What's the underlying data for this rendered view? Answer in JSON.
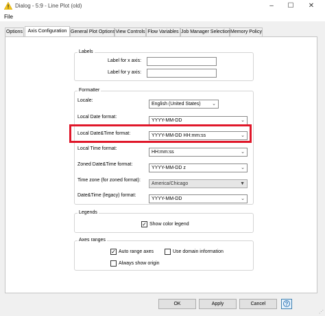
{
  "window": {
    "title": "Dialog - 5:9 - Line Plot (old)",
    "minimize": "–",
    "maximize": "☐",
    "close": "✕"
  },
  "menu": {
    "file": "File"
  },
  "tabs": [
    {
      "label": "Options",
      "active": false
    },
    {
      "label": "Axis Configuration",
      "active": true
    },
    {
      "label": "General Plot Options",
      "active": false
    },
    {
      "label": "View Controls",
      "active": false
    },
    {
      "label": "Flow Variables",
      "active": false
    },
    {
      "label": "Job Manager Selection",
      "active": false
    },
    {
      "label": "Memory Policy",
      "active": false
    }
  ],
  "labels_group": {
    "title": "Labels",
    "x_axis_label": "Label for x axis:",
    "x_axis_value": "",
    "y_axis_label": "Label for y axis:",
    "y_axis_value": ""
  },
  "formatter_group": {
    "title": "Formatter",
    "locale_label": "Locale:",
    "locale_value": "English (United States)",
    "local_date_label": "Local Date format:",
    "local_date_value": "YYYY-MM-DD",
    "local_datetime_label": "Local Date&Time format:",
    "local_datetime_value": "YYYY-MM-DD HH:mm:ss",
    "local_time_label": "Local Time format:",
    "local_time_value": "HH:mm:ss",
    "zoned_datetime_label": "Zoned Date&Time format:",
    "zoned_datetime_value": "YYYY-MM-DD z",
    "timezone_label": "Time zone (for zoned format):",
    "timezone_value": "America/Chicago",
    "legacy_datetime_label": "Date&Time (legacy) format:",
    "legacy_datetime_value": "YYYY-MM-DD"
  },
  "legends_group": {
    "title": "Legends",
    "show_color_legend": "Show color legend",
    "show_color_legend_checked": true
  },
  "axes_group": {
    "title": "Axes ranges",
    "auto_range": "Auto range axes",
    "auto_range_checked": true,
    "use_domain": "Use domain information",
    "use_domain_checked": false,
    "always_origin": "Always show origin",
    "always_origin_checked": false
  },
  "footer": {
    "ok": "OK",
    "apply": "Apply",
    "cancel": "Cancel",
    "help": "?"
  },
  "colors": {
    "highlight": "#e0172a",
    "warning_icon": "#f5c518"
  },
  "icons": {
    "dropdown": "▼",
    "check": "✓"
  }
}
